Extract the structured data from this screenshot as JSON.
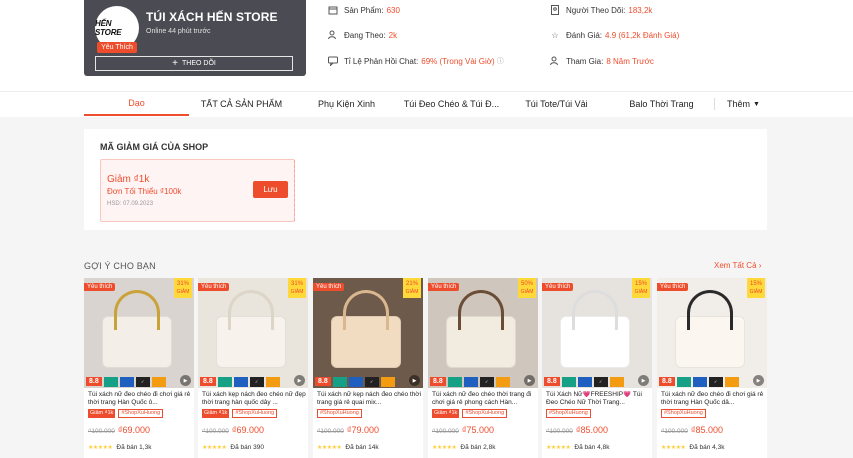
{
  "shop": {
    "avatar_text": "HẾN STORE",
    "badge": "Yêu Thích",
    "name": "TÚI XÁCH HẾN STORE",
    "online": "Online 44 phút trước",
    "follow_label": "THEO DÕI",
    "stats": {
      "products_label": "Sản Phẩm:",
      "products_value": "630",
      "following_label": "Đang Theo:",
      "following_value": "2k",
      "chat_label": "Tỉ Lệ Phản Hồi Chat:",
      "chat_value": "69% (Trong Vài Giờ)",
      "followers_label": "Người Theo Dõi:",
      "followers_value": "183,2k",
      "rating_label": "Đánh Giá:",
      "rating_value": "4.9 (61,2k Đánh Giá)",
      "joined_label": "Tham Gia:",
      "joined_value": "8 Năm Trước"
    }
  },
  "nav": {
    "tabs": [
      "Dạo",
      "TẤT CẢ SẢN PHẨM",
      "Phụ Kiện Xinh",
      "Túi Đeo Chéo & Túi Đ...",
      "Túi Tote/Túi Vải",
      "Balo Thời Trang"
    ],
    "more": "Thêm"
  },
  "voucher_section": {
    "title": "MÃ GIẢM GIÁ CỦA SHOP",
    "voucher": {
      "title": "Giảm ₫1k",
      "min": "Đơn Tối Thiểu ₫100k",
      "expiry": "HSD: 07.09.2023",
      "save_label": "Lưu"
    }
  },
  "recommend": {
    "title": "GỢI Ý CHO BẠN",
    "see_all": "Xem Tất Cả"
  },
  "colors": {
    "accent": "#ee4d2d",
    "header_card": "#4b4b53"
  },
  "products": [
    {
      "fav": "Yêu thích",
      "discount": "31%",
      "disc_label": "GIẢM",
      "score": "8.8",
      "name": "Túi xách nữ đeo chéo đi chơi giá rẻ thời trang Hàn Quốc ô...",
      "tag1": "Giảm ₫1k",
      "tag2": "#ShopXuHuong",
      "old_price": "₫100.000",
      "new_price": "₫69.000",
      "sold": "Đã bán 1,3k"
    },
    {
      "fav": "Yêu thích",
      "discount": "31%",
      "disc_label": "GIẢM",
      "score": "8.8",
      "name": "Túi xách kẹp nách đeo chéo nữ đẹp thời trang hàn quốc dây ...",
      "tag1": "Giảm ₫1k",
      "tag2": "#ShopXuHuong",
      "old_price": "₫100.000",
      "new_price": "₫69.000",
      "sold": "Đã bán 390"
    },
    {
      "fav": "Yêu thích",
      "discount": "21%",
      "disc_label": "GIẢM",
      "score": "8.8",
      "name": "Túi xách nữ kẹp nách đeo chéo thời trang giá rẻ quai mix...",
      "tag1": "",
      "tag2": "#ShopXuHuong",
      "old_price": "₫100.000",
      "new_price": "₫79.000",
      "sold": "Đã bán 14k"
    },
    {
      "fav": "Yêu thích",
      "discount": "50%",
      "disc_label": "GIẢM",
      "score": "8.8",
      "name": "Túi xách nữ đeo chéo thời trang đi chơi giá rẻ phong cách Hàn...",
      "tag1": "Giảm ₫1k",
      "tag2": "#ShopXuHuong",
      "old_price": "₫100.000",
      "new_price": "₫75.000",
      "sold": "Đã bán 2,8k"
    },
    {
      "fav": "Yêu thích",
      "discount": "15%",
      "disc_label": "GIẢM",
      "score": "8.8",
      "name": "Túi Xách Nữ💗FREESHIP💗 Túi Đeo Chéo Nữ Thời Trang...",
      "tag1": "",
      "tag2": "#ShopXuHuong",
      "old_price": "₫100.000",
      "new_price": "₫85.000",
      "sold": "Đã bán 4,8k"
    },
    {
      "fav": "Yêu thích",
      "discount": "15%",
      "disc_label": "GIẢM",
      "score": "8.8",
      "name": "Túi xách nữ đeo chéo đi chơi giá rẻ thời trang Hàn Quốc dâ...",
      "tag1": "",
      "tag2": "#ShopXuHuong",
      "old_price": "₫100.000",
      "new_price": "₫85.000",
      "sold": "Đã bán 4,3k"
    }
  ]
}
